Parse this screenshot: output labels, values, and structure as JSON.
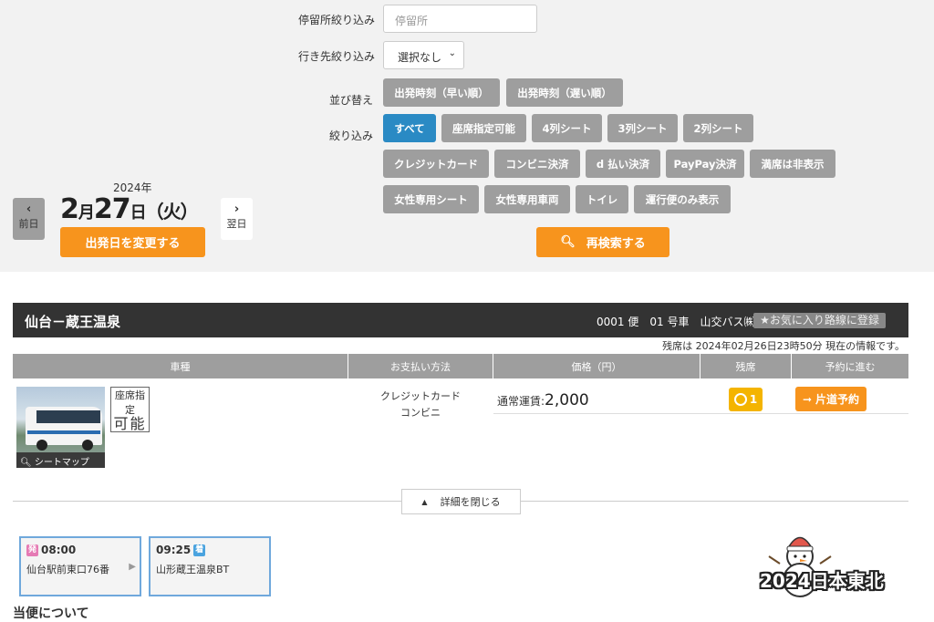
{
  "filters": {
    "stop_label": "停留所絞り込み",
    "stop_placeholder": "停留所",
    "dest_label": "行き先絞り込み",
    "dest_value": "選択なし",
    "sort_label": "並び替え",
    "sort_options": [
      "出発時刻（早い順）",
      "出発時刻（遅い順）"
    ],
    "filter_label": "絞り込み",
    "chips_row1": [
      "すべて",
      "座席指定可能",
      "4列シート",
      "3列シート",
      "2列シート"
    ],
    "chips_row2": [
      "クレジットカード",
      "コンビニ決済",
      "d 払い決済",
      "PayPay決済",
      "満席は非表示"
    ],
    "chips_row3": [
      "女性専用シート",
      "女性専用車両",
      "トイレ",
      "運行便のみ表示"
    ],
    "research_button": "再検索する"
  },
  "date": {
    "year": "2024年",
    "month": "2",
    "month_unit": "月",
    "day": "27",
    "day_unit": "日",
    "weekday": "（火）",
    "prev_label": "前日",
    "next_label": "翌日",
    "change_button": "出発日を変更する"
  },
  "route": {
    "title": "仙台－蔵王温泉",
    "info": "0001 便　01 号車　山交バス㈱",
    "fav_button": "★お気に入り路線に登録",
    "remain_note": "残席は 2024年02月26日23時50分 現在の情報です。"
  },
  "table": {
    "headers": [
      "車種",
      "お支払い方法",
      "価格（円）",
      "残席",
      "予約に進む"
    ],
    "seat_badge_top": "座席指定",
    "seat_badge_bottom": "可能",
    "seatmap": "シートマップ",
    "payments": [
      "クレジットカード",
      "コンビニ"
    ],
    "price_label": "通常運賃:",
    "price_value": "2,000",
    "seats_left": "1",
    "reserve_button": "片道予約"
  },
  "details": {
    "close_button": "詳細を閉じる",
    "departure": {
      "tag": "発",
      "time": "08:00",
      "stop": "仙台駅前東口76番"
    },
    "arrival": {
      "tag": "着",
      "time": "09:25",
      "stop": "山形蔵王温泉BT"
    },
    "section_title": "当便について"
  },
  "watermark": "2024日本東北",
  "colors": {
    "accent_orange": "#f7941d",
    "active_blue": "#2a8ac4",
    "chip_gray": "#9e9e9e",
    "header_dark": "#333333",
    "seat_yellow": "#f4b400"
  }
}
